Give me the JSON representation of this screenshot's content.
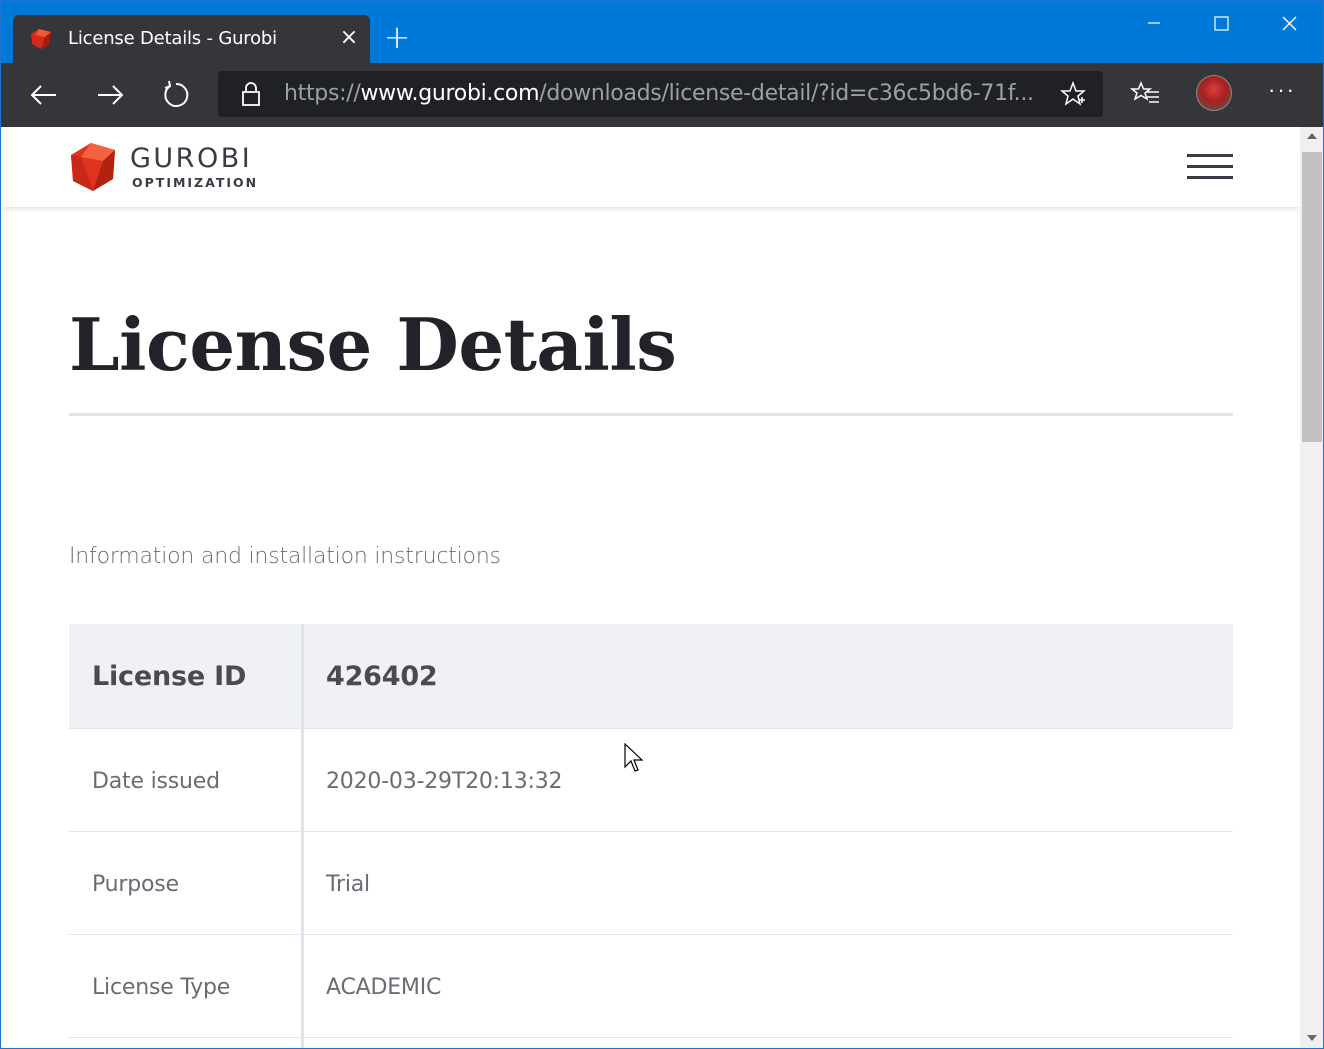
{
  "browser": {
    "tab": {
      "title": "License Details - Gurobi",
      "close_glyph": "×"
    },
    "new_tab_glyph": "+",
    "address": {
      "scheme": "https://",
      "host": "www.gurobi.com",
      "path": "/downloads/license-detail/?id=c36c5bd6-71f..."
    },
    "more_glyph": "···",
    "accent_color": "#0078d7",
    "toolbar_color": "#35363a"
  },
  "site": {
    "brand": "GUROBI",
    "brand_sub": "OPTIMIZATION",
    "brand_color": "#e0321c"
  },
  "page": {
    "title": "License Details",
    "subtitle": "Information and installation instructions",
    "table": {
      "rows": [
        {
          "label": "License ID",
          "value": "426402"
        },
        {
          "label": "Date issued",
          "value": "2020-03-29T20:13:32"
        },
        {
          "label": "Purpose",
          "value": "Trial"
        },
        {
          "label": "License Type",
          "value": "ACADEMIC"
        }
      ]
    }
  }
}
